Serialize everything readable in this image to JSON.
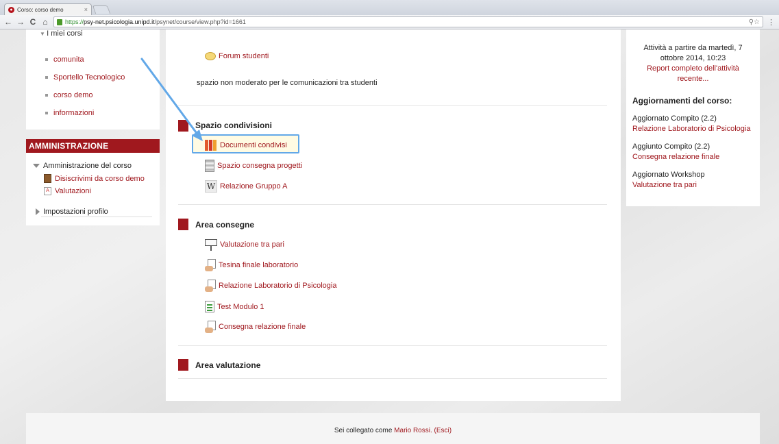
{
  "browser": {
    "tab_title": "Corso: corso demo",
    "tab_close": "×",
    "url_scheme": "https://",
    "url_host": "psy-net.psicologia.unipd.it",
    "url_path": "/psynet/course/view.php?id=1661",
    "nav_back": "←",
    "nav_forward": "→",
    "nav_reload": "C",
    "nav_home": "⌂",
    "omni_icons": "⚲☆"
  },
  "my_courses": {
    "title": "I miei corsi",
    "items": [
      {
        "label": "comunita"
      },
      {
        "label": "Sportello Tecnologico"
      },
      {
        "label": "corso demo"
      },
      {
        "label": "informazioni"
      }
    ]
  },
  "admin": {
    "header": "AMMINISTRAZIONE",
    "course_admin": "Amministrazione del corso",
    "unenrol": "Disiscrivimi da corso demo",
    "grades": "Valutazioni",
    "profile_settings": "Impostazioni profilo"
  },
  "main": {
    "forum_label": "Forum studenti",
    "forum_desc": "spazio non moderato per le comunicazioni tra studenti",
    "section1": {
      "title": "Spazio condivisioni",
      "items": [
        {
          "label": "Documenti condivisi"
        },
        {
          "label": "Spazio consegna progetti"
        },
        {
          "label": "Relazione Gruppo A"
        }
      ]
    },
    "section2": {
      "title": "Area consegne",
      "items": [
        {
          "label": "Valutazione tra pari"
        },
        {
          "label": "Tesina finale laboratorio"
        },
        {
          "label": "Relazione Laboratorio di Psicologia"
        },
        {
          "label": "Test Modulo 1"
        },
        {
          "label": "Consegna relazione finale"
        }
      ]
    },
    "section3": {
      "title": "Area valutazione"
    }
  },
  "recent": {
    "since": "Attività a partire da martedì, 7 ottobre 2014, 10:23",
    "full_report": "Report completo dell'attività recente...",
    "heading": "Aggiornamenti del corso:",
    "updates": [
      {
        "action": "Aggiornato Compito (2.2)",
        "link": "Relazione Laboratorio di Psicologia"
      },
      {
        "action": "Aggiunto Compito (2.2)",
        "link": "Consegna relazione finale"
      },
      {
        "action": "Aggiornato Workshop",
        "link": "Valutazione tra pari"
      }
    ]
  },
  "footer": {
    "logged_in_as": "Sei collegato come",
    "user_name": "Mario Rossi.",
    "logout": "(Esci)"
  },
  "colors": {
    "brand": "#a0181e",
    "highlight_border": "#62a8e8",
    "annotation_arrow": "#62a8e8"
  }
}
